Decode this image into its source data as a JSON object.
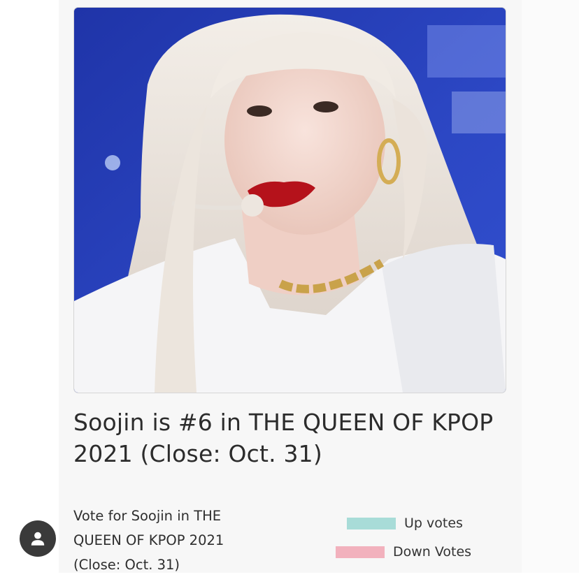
{
  "post": {
    "headline": "Soojin is #6 in THE QUEEN OF KPOP 2021 (Close: Oct. 31)",
    "vote_text": "Vote for Soojin in THE QUEEN OF KPOP 2021 (Close: Oct. 31)"
  },
  "legend": {
    "items": [
      {
        "label": "Up votes",
        "color": "#a8dcd8"
      },
      {
        "label": "Down Votes",
        "color": "#f2b1bd"
      }
    ]
  },
  "icons": {
    "avatar": "user-icon"
  }
}
